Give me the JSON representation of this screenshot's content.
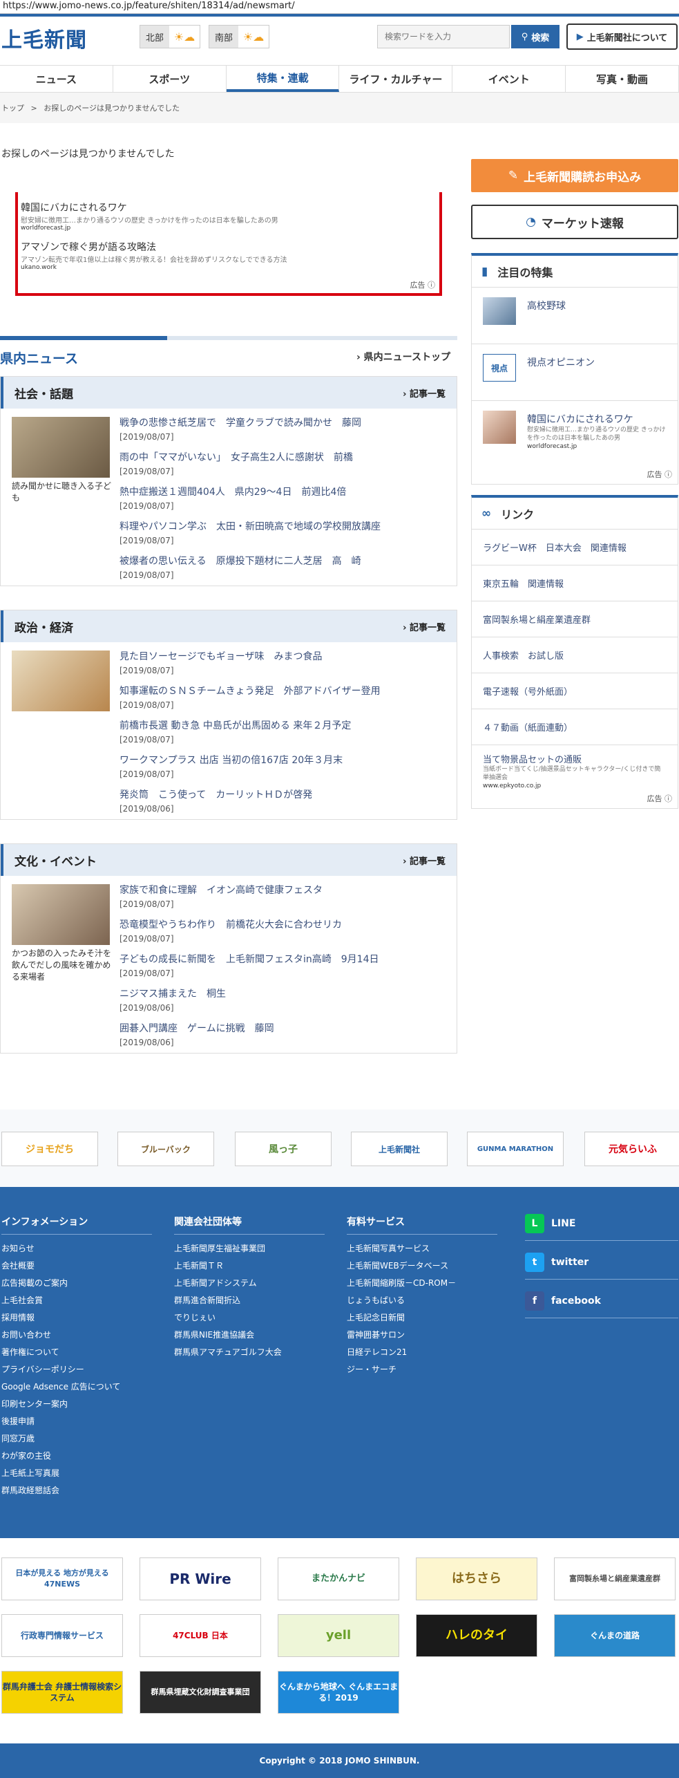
{
  "url": "https://www.jomo-news.co.jp/feature/shiten/18314/ad/newsmart/",
  "header": {
    "logo": "上毛新聞",
    "weather": [
      {
        "label": "北部"
      },
      {
        "label": "南部"
      }
    ],
    "search_placeholder": "検索ワードを入力",
    "search_btn": "検索",
    "about_btn": "上毛新聞社について"
  },
  "nav": [
    "ニュース",
    "スポーツ",
    "特集・連載",
    "ライフ・カルチャー",
    "イベント",
    "写真・動画"
  ],
  "breadcrumb": {
    "home": "トップ",
    "sep": ">",
    "current": "お探しのページは見つかりませんでした"
  },
  "notfound": "お探しのページは見つかりませんでした",
  "ad": {
    "items": [
      {
        "title": "韓国にバカにされるワケ",
        "desc": "慰安婦に徴用工…まかり通るウソの歴史 きっかけを作ったのは日本を騙したあの男",
        "src": "worldforecast.jp"
      },
      {
        "title": "アマゾンで稼ぐ男が語る攻略法",
        "desc": "アマゾン転売で年収1億以上は稼ぐ男が教える！会社を辞めずリスクなしでできる方法",
        "src": "ukano.work"
      }
    ],
    "label": "広告"
  },
  "section": {
    "title": "県内ニュース",
    "link": "県内ニューストップ"
  },
  "categories": [
    {
      "name": "社会・話題",
      "more": "記事一覧",
      "caption": "読み聞かせに聴き入る子ども",
      "items": [
        {
          "title": "戦争の悲惨さ紙芝居で　学童クラブで読み聞かせ　藤岡",
          "date": "[2019/08/07]"
        },
        {
          "title": "雨の中「ママがいない」　女子高生2人に感謝状　前橋",
          "date": "[2019/08/07]"
        },
        {
          "title": "熱中症搬送１週間404人　県内29～4日　前週比4倍",
          "date": "[2019/08/07]"
        },
        {
          "title": "料理やパソコン学ぶ　太田・新田暁高で地域の学校開放講座",
          "date": "[2019/08/07]"
        },
        {
          "title": "被爆者の思い伝える　原爆投下題材に二人芝居　高　崎",
          "date": "[2019/08/07]"
        }
      ]
    },
    {
      "name": "政治・経済",
      "more": "記事一覧",
      "caption": "",
      "items": [
        {
          "title": "見た目ソーセージでもギョーザ味　みまつ食品",
          "date": "[2019/08/07]"
        },
        {
          "title": "知事運転のＳＮＳチームきょう発足　外部アドバイザー登用",
          "date": "[2019/08/07]"
        },
        {
          "title": "前橋市長選 動き急 中島氏が出馬固める 来年２月予定",
          "date": "[2019/08/07]"
        },
        {
          "title": "ワークマンプラス 出店 当初の倍167店 20年３月末",
          "date": "[2019/08/07]"
        },
        {
          "title": "発炎筒　こう使って　カーリットＨＤが啓発",
          "date": "[2019/08/06]"
        }
      ]
    },
    {
      "name": "文化・イベント",
      "more": "記事一覧",
      "caption": "かつお節の入ったみそ汁を飲んでだしの風味を確かめる来場者",
      "items": [
        {
          "title": "家族で和食に理解　イオン高崎で健康フェスタ",
          "date": "[2019/08/07]"
        },
        {
          "title": "恐竜模型やうちわ作り　前橋花火大会に合わせリカ",
          "date": "[2019/08/07]"
        },
        {
          "title": "子どもの成長に新聞を　上毛新聞フェスタin高崎　9月14日",
          "date": "[2019/08/07]"
        },
        {
          "title": "ニジマス捕まえた　桐生",
          "date": "[2019/08/06]"
        },
        {
          "title": "囲碁入門講座　ゲームに挑戦　藤岡",
          "date": "[2019/08/06]"
        }
      ]
    }
  ],
  "sidebar": {
    "subscribe": "上毛新聞購読お申込み",
    "market": "マーケット速報",
    "featured_title": "注目の特集",
    "featured": [
      {
        "title": "高校野球"
      },
      {
        "title": "視点オピニオン"
      },
      {
        "title": "韓国にバカにされるワケ",
        "desc": "慰安婦に徴用工…まかり通るウソの歴史 きっかけを作ったのは日本を騙したあの男",
        "src": "worldforecast.jp"
      }
    ],
    "ad_label": "広告",
    "links_title": "リンク",
    "links": [
      "ラグビーW杯　日本大会　関連情報",
      "東京五輪　関連情報",
      "富岡製糸場と絹産業遺産群",
      "人事検索　お試し版",
      "電子速報（号外紙面）",
      "４７動画（紙面連動）"
    ],
    "link_ad": {
      "title": "当て物景品セットの通販",
      "desc": "当紙ボード当てくじ/抽選景品セットキャラクター/くじ付きで簡単抽選会",
      "src": "www.epkyoto.co.jp"
    }
  },
  "banners": [
    "ジョモだち",
    "ブルーバック",
    "風っ子",
    "上毛新聞社",
    "GUNMA MARATHON",
    "元気らいふ"
  ],
  "footer": {
    "cols": [
      {
        "title": "インフォメーション",
        "items": [
          "お知らせ",
          "会社概要",
          "広告掲載のご案内",
          "上毛社会賞",
          "採用情報",
          "お問い合わせ",
          "著作権について",
          "プライバシーポリシー",
          "Google Adsence 広告について",
          "印刷センター案内",
          "後援申請",
          "同窓万歳",
          "わが家の主役",
          "上毛紙上写真展",
          "群馬政経懇話会"
        ]
      },
      {
        "title": "関連会社団体等",
        "items": [
          "上毛新聞厚生福祉事業団",
          "上毛新聞ＴＲ",
          "上毛新聞アドシステム",
          "群馬進合新聞折込",
          "でりじぇい",
          "群馬県NIE推進協議会",
          "群馬県アマチュアゴルフ大会"
        ]
      },
      {
        "title": "有料サービス",
        "items": [
          "上毛新聞写真サービス",
          "上毛新聞WEBデータベース",
          "上毛新聞縮刷版－CD-ROM－",
          "じょうもばいる",
          "上毛記念日新聞",
          "雷神囲碁サロン",
          "日経テレコン21",
          "ジー・サーチ"
        ]
      }
    ],
    "sns": [
      "LINE",
      "twitter",
      "facebook"
    ]
  },
  "partners": [
    "日本が見える 地方が見える 47NEWS",
    "PR Wire",
    "またかんナビ",
    "はちさら",
    "富岡製糸場と絹産業遺産群",
    "行政専門情報サービス",
    "47CLUB",
    "日本",
    "yell",
    "ハレのタイ",
    "ぐんまの道路",
    "群馬弁護士会 弁護士情報検索システム",
    "群馬県埋蔵文化財調査事業団",
    "ぐんまから地球へ ぐんまエコまる！2019"
  ],
  "copyright": "Copyright © 2018 JOMO SHINBUN.",
  "colors": {
    "brand": "#2a66a8",
    "accent": "#f28c3c",
    "ad_border": "#d7000f"
  }
}
